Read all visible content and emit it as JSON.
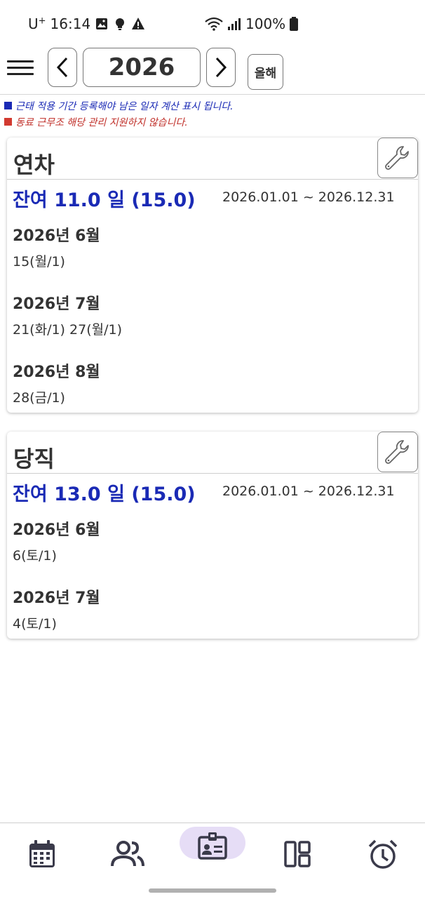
{
  "status": {
    "carrier": "U",
    "carrier_sup": "+",
    "time": "16:14",
    "battery": "100%"
  },
  "toolbar": {
    "year": "2026",
    "prev_label": "<",
    "next_label": ">",
    "today_label": "올해"
  },
  "notices": [
    "근태 적용 기간 등록해야 남은 일자 계산 표시 됩니다.",
    "동료 근무조 해당 관리 지원하지 않습니다."
  ],
  "cards": [
    {
      "title": "연차",
      "remaining": "잔여 11.0 일 (15.0)",
      "period": "2026.01.01 ~ 2026.12.31",
      "months": [
        {
          "title": "2026년 6월",
          "days": "15(월/1)"
        },
        {
          "title": "2026년 7월",
          "days": "21(화/1) 27(월/1)"
        },
        {
          "title": "2026년 8월",
          "days": "28(금/1)"
        }
      ]
    },
    {
      "title": "당직",
      "remaining": "잔여 13.0 일 (15.0)",
      "period": "2026.01.01 ~ 2026.12.31",
      "months": [
        {
          "title": "2026년 6월",
          "days": "6(토/1)"
        },
        {
          "title": "2026년 7월",
          "days": "4(토/1)"
        }
      ]
    }
  ],
  "bottom_nav": {
    "items": [
      "calendar-icon",
      "people-icon",
      "id-badge-icon",
      "dashboard-icon",
      "alarm-icon"
    ],
    "active_index": 2
  },
  "colors": {
    "accent_blue": "#1a2ab5",
    "notice_red": "#c0302a",
    "nav_active_bg": "#e6ddf6"
  }
}
